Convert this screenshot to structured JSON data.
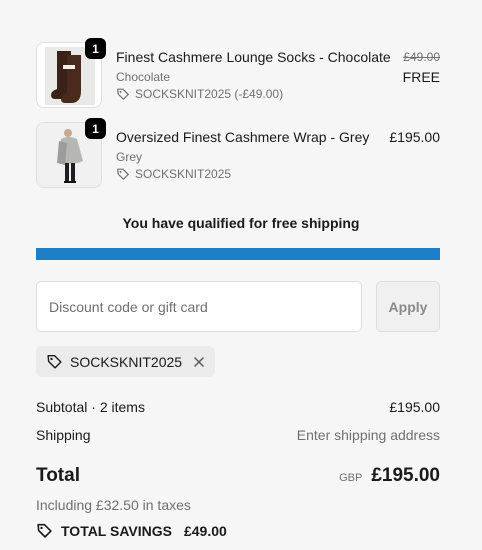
{
  "items": [
    {
      "quantity": "1",
      "title": "Finest Cashmere Lounge Socks - Chocolate",
      "variant": "Chocolate",
      "discount": "SOCKSKNIT2025 (-£49.00)",
      "original_price": "£49.00",
      "price": "FREE",
      "icon": "tag-icon",
      "image": "socks-product-image"
    },
    {
      "quantity": "1",
      "title": "Oversized Finest Cashmere Wrap - Grey",
      "variant": "Grey",
      "discount": "SOCKSKNIT2025",
      "price": "£195.00",
      "icon": "tag-icon",
      "image": "wrap-product-image"
    }
  ],
  "shipping_banner": {
    "message": "You have qualified for free shipping",
    "progress": 1.0,
    "color": "#1e7ec8"
  },
  "discount": {
    "placeholder": "Discount code or gift card",
    "value": "",
    "apply_label": "Apply",
    "applied_code": "SOCKSKNIT2025"
  },
  "summary": {
    "subtotal_label": "Subtotal · 2 items",
    "subtotal_value": "£195.00",
    "shipping_label": "Shipping",
    "shipping_value": "Enter shipping address",
    "total_label": "Total",
    "currency": "GBP",
    "total_value": "£195.00",
    "taxes": "Including £32.50 in taxes",
    "savings_label": "TOTAL SAVINGS",
    "savings_value": "£49.00"
  }
}
